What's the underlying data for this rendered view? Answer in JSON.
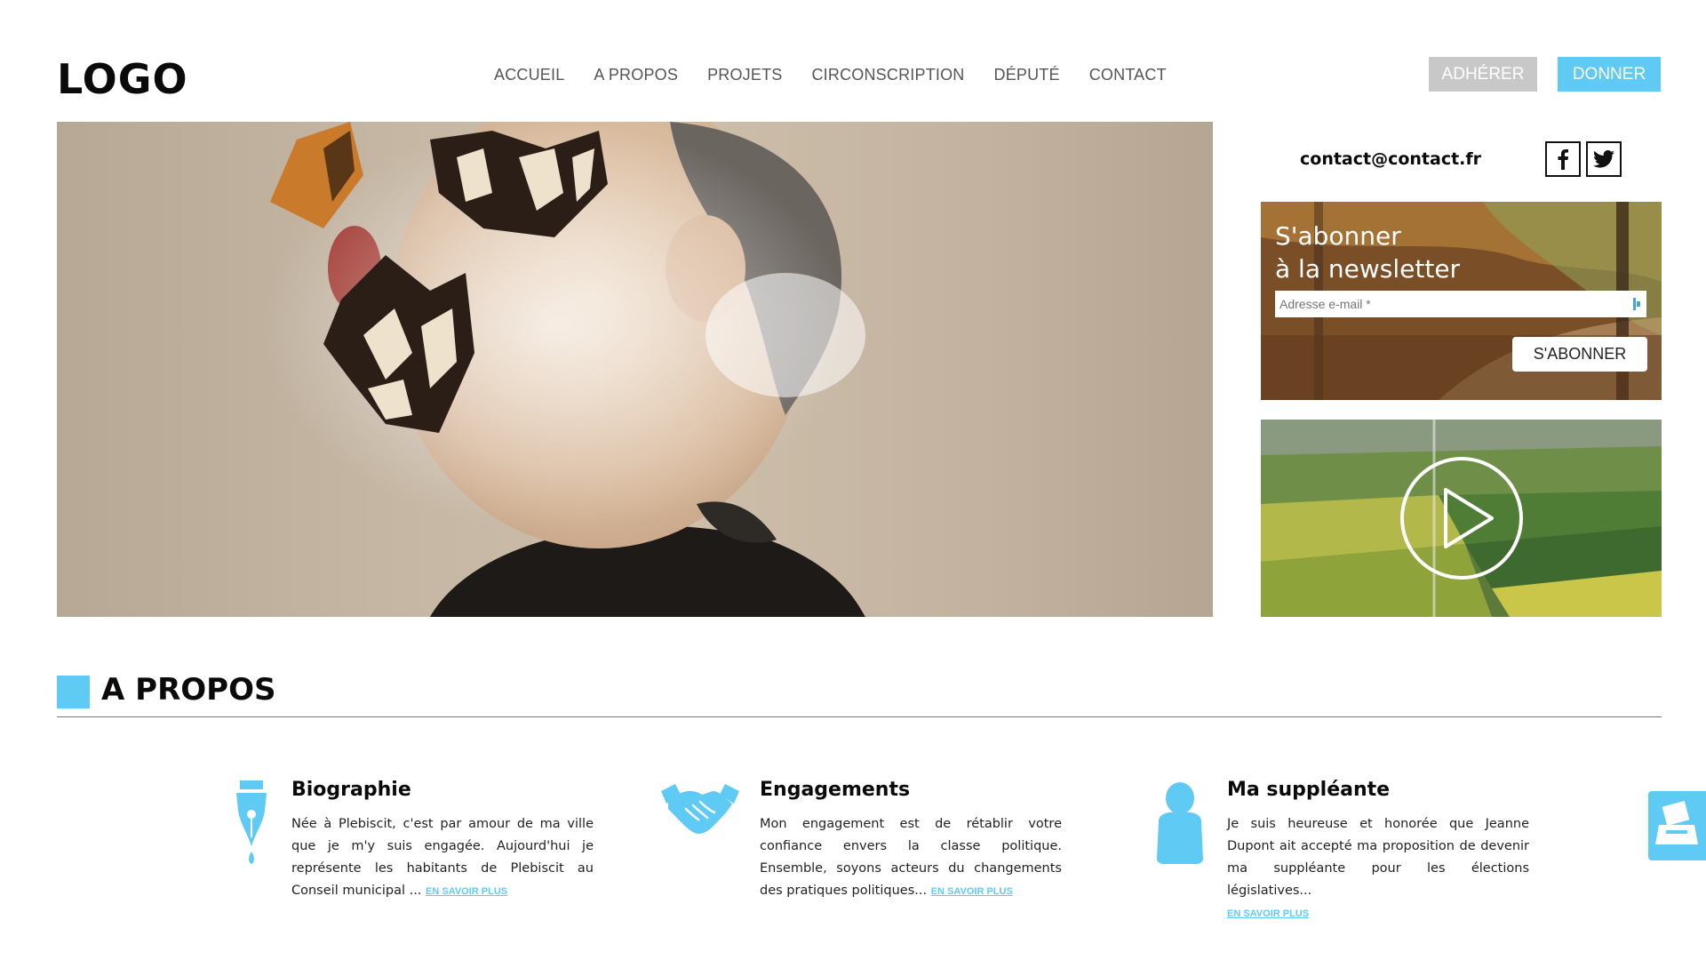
{
  "header": {
    "logo": "LOGO",
    "nav": [
      "ACCUEIL",
      "A PROPOS",
      "PROJETS",
      "CIRCONSCRIPTION",
      "DÉPUTÉ",
      "CONTACT"
    ],
    "adherer_label": "ADHÉRER",
    "donner_label": "DONNER"
  },
  "sidebar": {
    "email": "contact@contact.fr",
    "social_icons": [
      "facebook-icon",
      "twitter-icon"
    ],
    "newsletter": {
      "title_line1": "S'abonner",
      "title_line2": "à la newsletter",
      "email_placeholder": "Adresse e-mail *",
      "button_label": "S'ABONNER"
    },
    "video": {
      "icon": "play-icon"
    }
  },
  "about": {
    "title": "A PROPOS",
    "features": [
      {
        "icon": "fountain-pen-icon",
        "title": "Biographie",
        "text": "Née à Plebiscit, c'est par amour de ma ville que je m'y suis engagée. Aujourd'hui je représente les habitants de Plebiscit au Conseil municipal ...",
        "link": "EN SAVOIR PLUS"
      },
      {
        "icon": "handshake-icon",
        "title": "Engagements",
        "text": "Mon engagement est de rétablir votre confiance envers la classe politique. Ensemble, soyons acteurs du changements des pratiques politiques...",
        "link": "EN SAVOIR PLUS"
      },
      {
        "icon": "person-icon",
        "title": "Ma suppléante",
        "text": "Je suis heureuse et honorée que Jeanne Dupont ait accepté ma proposition de devenir ma suppléante pour les élections législatives...",
        "link": "EN SAVOIR PLUS"
      }
    ]
  },
  "colors": {
    "accent": "#5fcaf3",
    "adherer_bg": "#c8c8c8",
    "text": "#0a0a0a"
  },
  "side_tab_icon": "vote-icon"
}
